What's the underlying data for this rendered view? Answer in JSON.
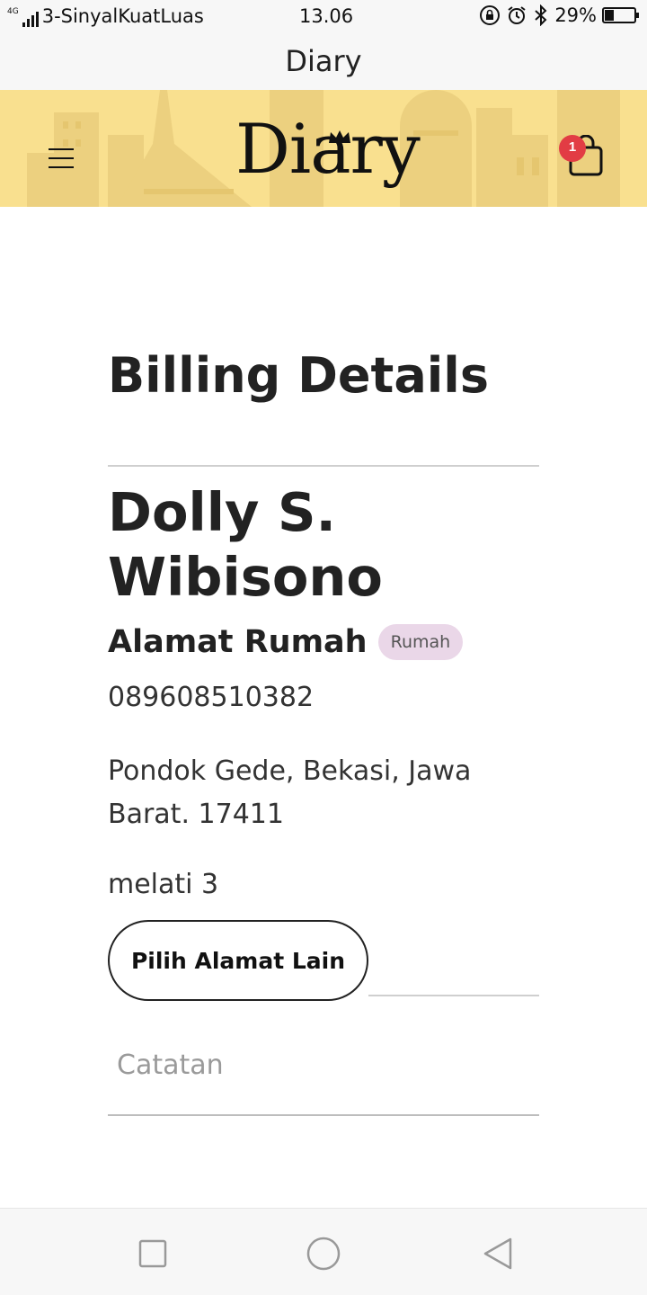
{
  "status_bar": {
    "network": "4G",
    "carrier": "3-SinyalKuatLuas",
    "time": "13.06",
    "battery_percent": "29%",
    "battery_level": 0.29,
    "icons": [
      "signal-icon",
      "rotation-lock-icon",
      "alarm-icon",
      "bluetooth-icon",
      "battery-icon"
    ]
  },
  "app_bar": {
    "title": "Diary"
  },
  "header": {
    "logo_text": "Diary",
    "menu_icon": "hamburger-menu-icon",
    "cart_icon": "shopping-bag-icon",
    "cart_count": "1",
    "colors": {
      "background": "#f9e08f",
      "badge": "#e23c44"
    }
  },
  "billing": {
    "title": "Billing Details",
    "name": "Dolly S. Wibisono",
    "address_label": "Alamat Rumah",
    "address_tag": "Rumah",
    "phone": "089608510382",
    "address": "Pondok Gede, Bekasi, Jawa Barat. 17411",
    "address_detail": "melati 3",
    "change_address_button": "Pilih Alamat Lain",
    "notes_placeholder": "Catatan"
  },
  "nav_bar": {
    "buttons": [
      "recent-apps-icon",
      "home-icon",
      "back-icon"
    ]
  }
}
